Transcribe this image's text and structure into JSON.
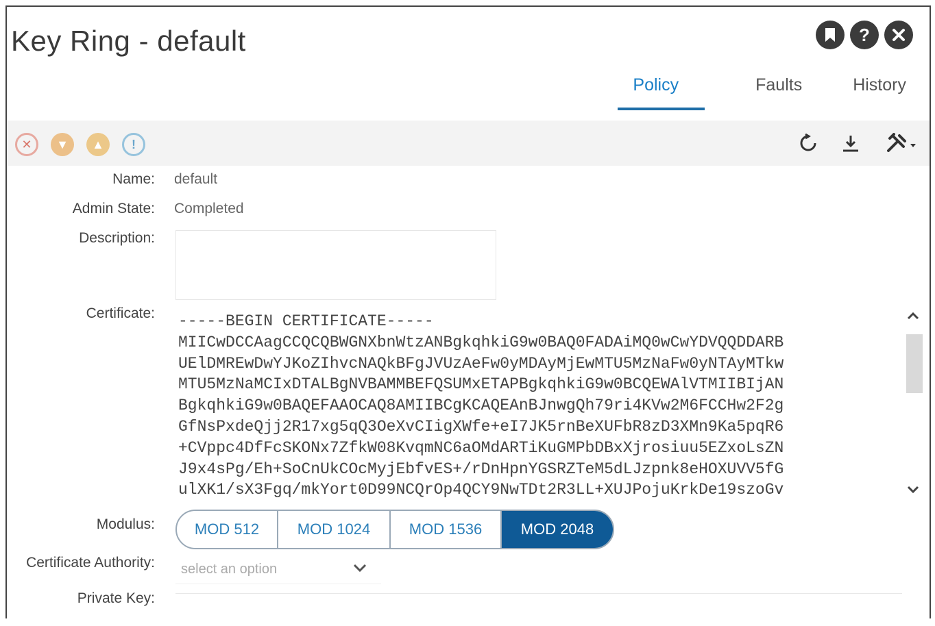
{
  "window": {
    "title": "Key Ring - default",
    "icons": [
      "bookmark-icon",
      "help-icon",
      "close-icon"
    ]
  },
  "tabs": [
    {
      "label": "Policy",
      "active": true
    },
    {
      "label": "Faults",
      "active": false
    },
    {
      "label": "History",
      "active": false
    }
  ],
  "toolbar": {
    "fault_icons": [
      "critical-fault-icon",
      "major-fault-icon",
      "minor-fault-icon",
      "warning-fault-icon"
    ],
    "action_icons": [
      "refresh-icon",
      "download-icon",
      "tools-icon"
    ]
  },
  "form": {
    "name_label": "Name:",
    "name_value": "default",
    "admin_state_label": "Admin State:",
    "admin_state_value": "Completed",
    "description_label": "Description:",
    "description_value": "",
    "certificate_label": "Certificate:",
    "certificate_lines": [
      "-----BEGIN CERTIFICATE-----",
      "MIICwDCCAagCCQCQBWGNXbnWtzANBgkqhkiG9w0BAQ0FADAiMQ0wCwYDVQQDDARB",
      "UElDMREwDwYJKoZIhvcNAQkBFgJVUzAeFw0yMDAyMjEwMTU5MzNaFw0yNTAyMTkw",
      "MTU5MzNaMCIxDTALBgNVBAMMBEFQSUMxETAPBgkqhkiG9w0BCQEWAlVTMIIBIjAN",
      "BgkqhkiG9w0BAQEFAAOCAQ8AMIIBCgKCAQEAnBJnwgQh79ri4KVw2M6FCCHw2F2g",
      "GfNsPxdeQjj2R17xg5qQ3OeXvCIigXWfe+eI7JK5rnBeXUFbR8zD3XMn9Ka5pqR6",
      "+CVppc4DfFcSKONx7ZfkW08KvqmNC6aOMdARTiKuGMPbDBxXjrosiuu5EZxoLsZN",
      "J9x4sPg/Eh+SoCnUkCOcMyjEbfvES+/rDnHpnYGSRZTeM5dLJzpnk8eHOXUVV5fG",
      "ulXK1/sX3Fgq/mkYort0D99NCQrOp4QCY9NwTDt2R3LL+XUJPojuKrkDe19szoGv"
    ],
    "modulus_label": "Modulus:",
    "modulus_options": [
      "MOD 512",
      "MOD 1024",
      "MOD 1536",
      "MOD 2048"
    ],
    "modulus_selected": "MOD 2048",
    "ca_label": "Certificate Authority:",
    "ca_placeholder": "select an option",
    "private_key_label": "Private Key:"
  },
  "colors": {
    "accent": "#1a7fc7",
    "selected_bg": "#0f5a96",
    "critical": "#d9534f",
    "major": "#e8a95b",
    "minor": "#e7b55b",
    "warning": "#5ba3c9"
  }
}
